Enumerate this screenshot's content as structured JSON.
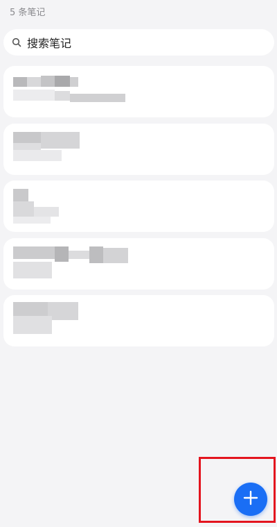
{
  "header": {
    "note_count": "5 条笔记"
  },
  "search": {
    "placeholder": "搜索笔记",
    "icon": "search-icon"
  },
  "notes": [
    {
      "title": "",
      "content_obscured": true
    },
    {
      "title": "",
      "content_obscured": true
    },
    {
      "title": "",
      "content_obscured": true
    },
    {
      "title": "",
      "content_obscured": true
    },
    {
      "title": "",
      "content_obscured": true
    }
  ],
  "fab": {
    "icon": "plus-icon",
    "color": "#1a6ef5"
  },
  "annotation": {
    "color": "#e3141e"
  }
}
